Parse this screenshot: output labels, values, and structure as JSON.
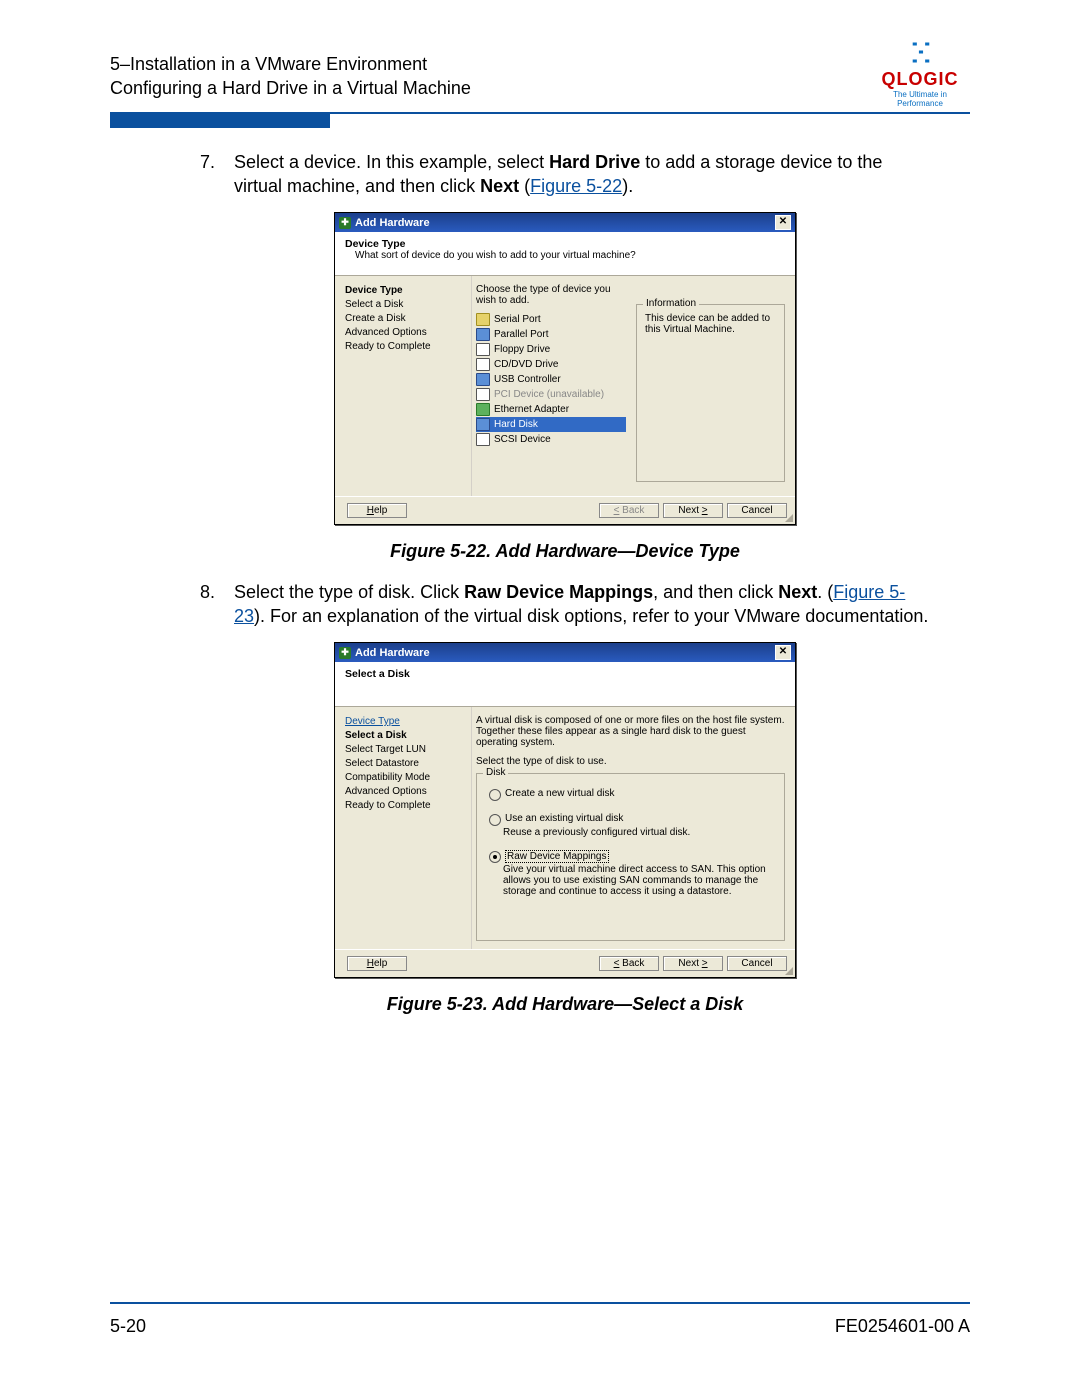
{
  "header": {
    "line1": "5–Installation in a VMware Environment",
    "line2": "Configuring a Hard Drive in a Virtual Machine",
    "logo_name": "QLOGIC",
    "logo_tag": "The Ultimate in Performance"
  },
  "step7": {
    "num": "7.",
    "text_a": "Select a device. In this example, select ",
    "bold_a": "Hard Drive",
    "text_b": " to add a storage device to the virtual machine, and then click ",
    "bold_b": "Next",
    "text_c": " (",
    "link": "Figure 5-22",
    "text_d": ")."
  },
  "fig22": {
    "title": "Add Hardware",
    "sub_h": "Device Type",
    "sub_d": "What sort of device do you wish to add to your virtual machine?",
    "nav": {
      "h": "Device Type",
      "i1": "Select a Disk",
      "i2": "Create a Disk",
      "i3": "Advanced Options",
      "i4": "Ready to Complete"
    },
    "main_prompt": "Choose the type of device you wish to add.",
    "devices": {
      "d1": "Serial Port",
      "d2": "Parallel Port",
      "d3": "Floppy Drive",
      "d4": "CD/DVD Drive",
      "d5": "USB Controller",
      "d6": "PCI Device (unavailable)",
      "d7": "Ethernet Adapter",
      "d8": "Hard Disk",
      "d9": "SCSI Device"
    },
    "info_title": "Information",
    "info_text": "This device can be added to this Virtual Machine.",
    "btn_help": "Help",
    "btn_back": "< Back",
    "btn_next": "Next >",
    "btn_cancel": "Cancel",
    "caption": "Figure 5-22. Add Hardware—Device Type"
  },
  "step8": {
    "num": "8.",
    "text_a": "Select the type of disk. Click ",
    "bold_a": "Raw Device Mappings",
    "text_b": ", and then click ",
    "bold_b": "Next",
    "text_c": ". (",
    "link": "Figure 5-23",
    "text_d": "). For an explanation of the virtual disk options, refer to your VMware documentation."
  },
  "fig23": {
    "title": "Add Hardware",
    "sub_h": "Select a Disk",
    "sub_d": "",
    "nav": {
      "l1": "Device Type",
      "cur": "Select a Disk",
      "i1": "Select Target LUN",
      "i2": "Select Datastore",
      "i3": "Compatibility Mode",
      "i4": "Advanced Options",
      "i5": "Ready to Complete"
    },
    "desc": "A virtual disk is composed of one or more files on the host file system. Together these files appear as a single hard disk to the guest operating system.",
    "prompt": "Select the type of disk to use.",
    "group": "Disk",
    "r1": "Create a new virtual disk",
    "r2": "Use an existing virtual disk",
    "r2s": "Reuse a previously configured virtual disk.",
    "r3": "Raw Device Mappings",
    "r3s": "Give your virtual machine direct access to SAN. This option allows you to use existing SAN commands to manage the storage and continue to access it using a datastore.",
    "btn_help": "Help",
    "btn_back": "< Back",
    "btn_next": "Next >",
    "btn_cancel": "Cancel",
    "caption": "Figure 5-23. Add Hardware—Select a Disk"
  },
  "footer": {
    "page": "5-20",
    "doc": "FE0254601-00 A"
  }
}
